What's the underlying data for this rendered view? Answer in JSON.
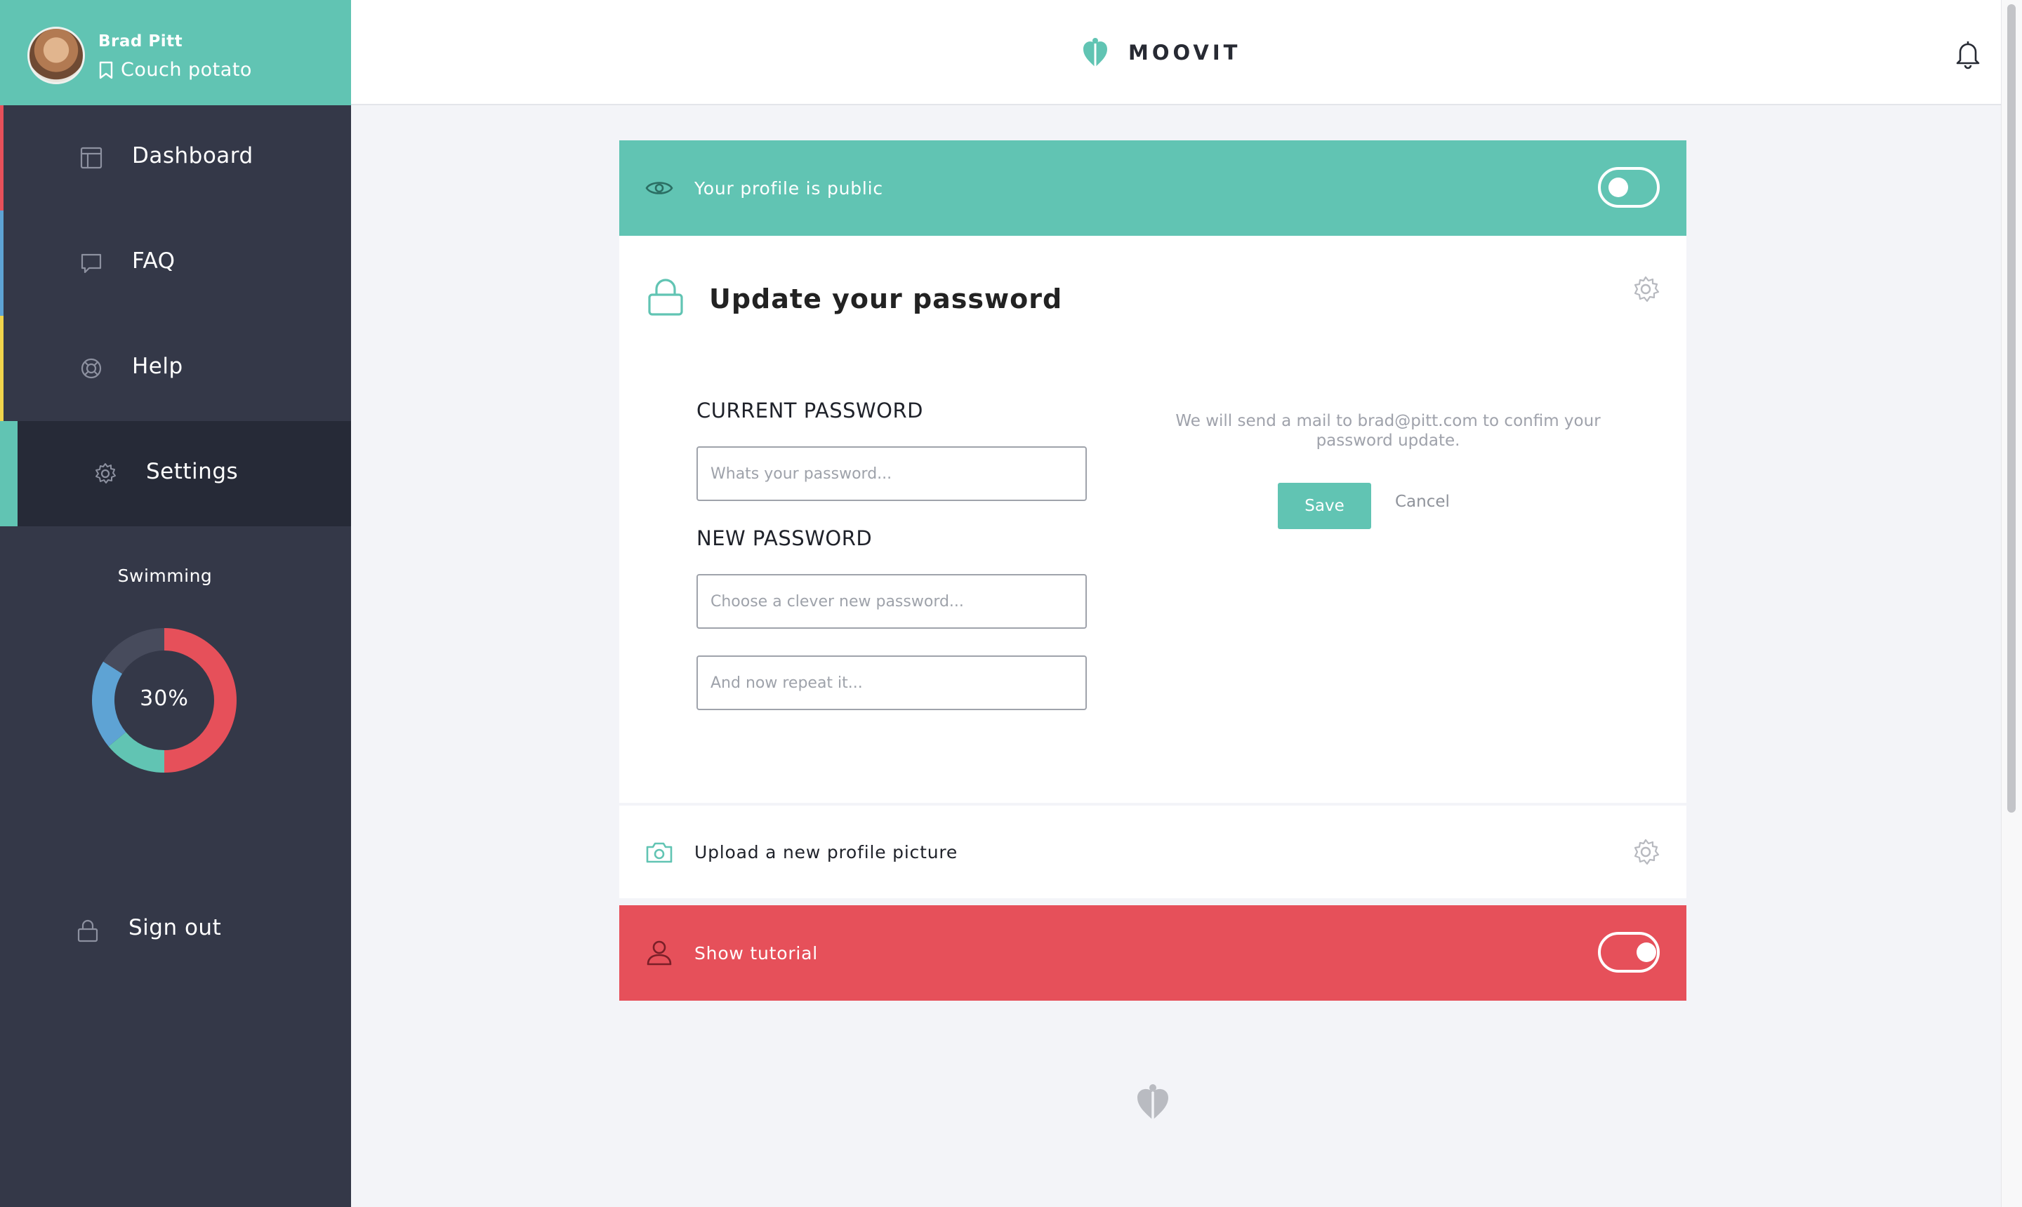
{
  "user": {
    "name": "Brad Pitt",
    "status": "Couch potato"
  },
  "nav": {
    "items": [
      {
        "label": "Dashboard",
        "icon": "dashboard-icon",
        "color": "#e6505a"
      },
      {
        "label": "FAQ",
        "icon": "chat-bubble-icon",
        "color": "#5ea3d4"
      },
      {
        "label": "Help",
        "icon": "lifebuoy-icon",
        "color": "#f0d44c"
      },
      {
        "label": "Settings",
        "icon": "gear-icon",
        "color": "#61c4b3",
        "active": true
      }
    ],
    "signout_label": "Sign out"
  },
  "activity": {
    "title": "Swimming",
    "percent_label": "30%",
    "segments": [
      {
        "color": "#e6505a",
        "fraction": 0.5
      },
      {
        "color": "#61c4b3",
        "fraction": 0.14
      },
      {
        "color": "#5ea3d4",
        "fraction": 0.2
      },
      {
        "color": "#474b5c",
        "fraction": 0.16
      }
    ]
  },
  "header": {
    "brand": "MOOVIT"
  },
  "settings": {
    "public_label": "Your profile is public",
    "public_toggle_on": false,
    "password_title": "Update your password",
    "current_label": "CURRENT PASSWORD",
    "current_placeholder": "Whats your password...",
    "new_label": "NEW PASSWORD",
    "new_placeholder": "Choose a clever new password...",
    "repeat_placeholder": "And now repeat it...",
    "info_text": "We will send a mail to brad@pitt.com to confim your password update.",
    "save_label": "Save",
    "cancel_label": "Cancel",
    "upload_label": "Upload a new profile picture",
    "tutorial_label": "Show tutorial",
    "tutorial_toggle_on": true
  },
  "colors": {
    "accent": "#61c4b3",
    "danger": "#e6505a",
    "sidebar": "#343848",
    "sidebar_active": "#262a37"
  }
}
